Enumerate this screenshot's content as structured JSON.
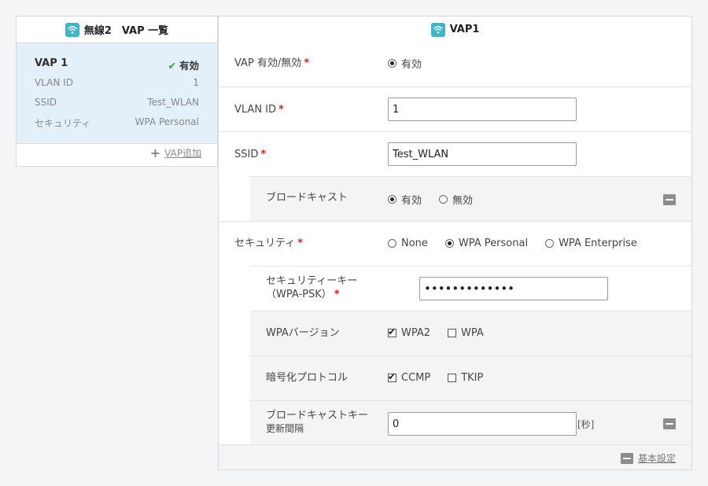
{
  "left_panel": {
    "title": "無線2　VAP 一覧",
    "vap_card": {
      "name": "VAP 1",
      "status": "有効",
      "fields": [
        {
          "label": "VLAN ID",
          "value": "1"
        },
        {
          "label": "SSID",
          "value": "Test_WLAN"
        },
        {
          "label": "セキュリティ",
          "value": "WPA Personal"
        }
      ]
    },
    "add_vap_label": "VAP追加"
  },
  "right_panel": {
    "title": "VAP1",
    "vap_enable": {
      "label": "VAP 有効/無効",
      "option": "有効"
    },
    "vlan_id": {
      "label": "VLAN ID",
      "value": "1"
    },
    "ssid": {
      "label": "SSID",
      "value": "Test_WLAN"
    },
    "broadcast": {
      "label": "ブロードキャスト",
      "options": [
        "有効",
        "無効"
      ],
      "selected": "有効"
    },
    "security": {
      "label": "セキュリティ",
      "options": [
        "None",
        "WPA Personal",
        "WPA Enterprise"
      ],
      "selected": "WPA Personal"
    },
    "security_key": {
      "label_line1": "セキュリティーキー",
      "label_line2": "（WPA-PSK）",
      "value": "•••••••••••••"
    },
    "wpa_version": {
      "label": "WPAバージョン",
      "options": [
        {
          "label": "WPA2",
          "checked": true
        },
        {
          "label": "WPA",
          "checked": false
        }
      ]
    },
    "encryption": {
      "label": "暗号化プロトコル",
      "options": [
        {
          "label": "CCMP",
          "checked": true
        },
        {
          "label": "TKIP",
          "checked": false
        }
      ]
    },
    "broadcast_key_interval": {
      "label_line1": "ブロードキャストキー",
      "label_line2": "更新間隔",
      "value": "0",
      "unit": "[秒]"
    },
    "basic_settings_label": "基本設定"
  },
  "colors": {
    "accent": "#3fb6c8",
    "required": "#e02020",
    "selected_card": "#e3eff9",
    "check": "#2ca02c"
  }
}
